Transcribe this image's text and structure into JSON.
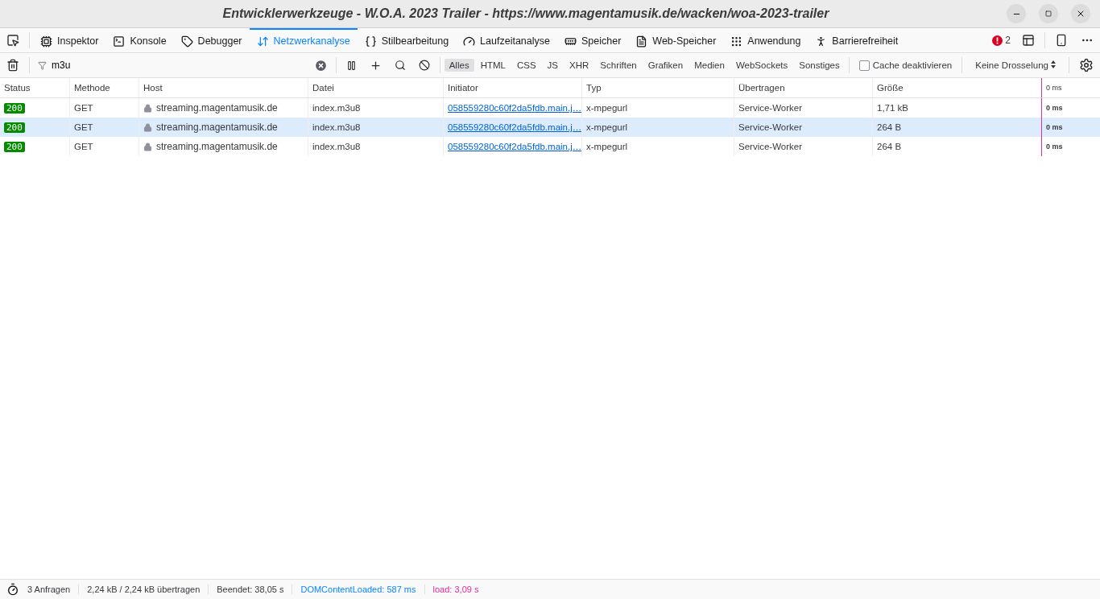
{
  "window": {
    "title": "Entwicklerwerkzeuge - W.O.A. 2023 Trailer - https://www.magentamusik.de/wacken/woa-2023-trailer"
  },
  "tools": [
    {
      "label": "Inspektor",
      "selected": false,
      "kind": "inspector"
    },
    {
      "label": "Konsole",
      "selected": false,
      "kind": "console"
    },
    {
      "label": "Debugger",
      "selected": false,
      "kind": "debugger"
    },
    {
      "label": "Netzwerkanalyse",
      "selected": true,
      "kind": "network"
    },
    {
      "label": "Stilbearbeitung",
      "selected": false,
      "kind": "style"
    },
    {
      "label": "Laufzeitanalyse",
      "selected": false,
      "kind": "performance"
    },
    {
      "label": "Speicher",
      "selected": false,
      "kind": "memory"
    },
    {
      "label": "Web-Speicher",
      "selected": false,
      "kind": "storage"
    },
    {
      "label": "Anwendung",
      "selected": false,
      "kind": "application"
    },
    {
      "label": "Barrierefreiheit",
      "selected": false,
      "kind": "accessibility"
    }
  ],
  "error_count": "2",
  "filter": {
    "value": "m3u"
  },
  "type_filters": [
    {
      "label": "Alles",
      "selected": true
    },
    {
      "label": "HTML",
      "selected": false
    },
    {
      "label": "CSS",
      "selected": false
    },
    {
      "label": "JS",
      "selected": false
    },
    {
      "label": "XHR",
      "selected": false
    },
    {
      "label": "Schriften",
      "selected": false
    },
    {
      "label": "Grafiken",
      "selected": false
    },
    {
      "label": "Medien",
      "selected": false
    },
    {
      "label": "WebSockets",
      "selected": false
    },
    {
      "label": "Sonstiges",
      "selected": false
    }
  ],
  "cache": {
    "label": "Cache deaktivieren",
    "checked": false
  },
  "throttling": "Keine Drosselung",
  "table": {
    "columns": [
      "Status",
      "Methode",
      "Host",
      "Datei",
      "Initiator",
      "Typ",
      "Übertragen",
      "Größe",
      "0 ms"
    ],
    "rows": [
      {
        "status": "200",
        "method": "GET",
        "host": "streaming.magentamusik.de",
        "file": "index.m3u8",
        "initiator": "058559280c60f2da5fdb.main.j…",
        "type": "x-mpegurl",
        "transferred": "Service-Worker",
        "size": "1,71 kB",
        "timing": "0 ms",
        "selected": false
      },
      {
        "status": "200",
        "method": "GET",
        "host": "streaming.magentamusik.de",
        "file": "index.m3u8",
        "initiator": "058559280c60f2da5fdb.main.j…",
        "type": "x-mpegurl",
        "transferred": "Service-Worker",
        "size": "264 B",
        "timing": "0 ms",
        "selected": true
      },
      {
        "status": "200",
        "method": "GET",
        "host": "streaming.magentamusik.de",
        "file": "index.m3u8",
        "initiator": "058559280c60f2da5fdb.main.j…",
        "type": "x-mpegurl",
        "transferred": "Service-Worker",
        "size": "264 B",
        "timing": "0 ms",
        "selected": false
      }
    ]
  },
  "status_bar": {
    "requests": "3 Anfragen",
    "transferred": "2,24 kB / 2,24 kB übertragen",
    "finished": "Beendet: 38,05 s",
    "dom_content_loaded": "DOMContentLoaded: 587 ms",
    "load": "load: 3,09 s"
  }
}
